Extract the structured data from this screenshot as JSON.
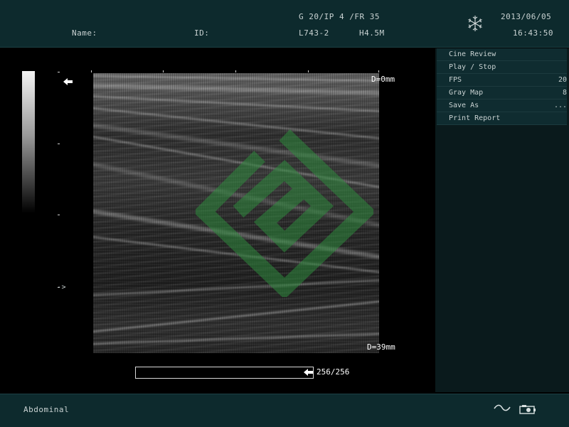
{
  "header": {
    "name_label": "Name:",
    "id_label": "ID:",
    "params": "G 20/IP 4 /FR 35",
    "probe": "L743-2",
    "frequency": "H4.5M",
    "date": "2013/06/05",
    "time": "16:43:50",
    "freeze_icon": "snowflake-icon"
  },
  "menu": {
    "items": [
      {
        "label": "Cine Review",
        "value": ""
      },
      {
        "label": "Play / Stop",
        "value": ""
      },
      {
        "label": "FPS",
        "value": "20"
      },
      {
        "label": "Gray Map",
        "value": "8"
      },
      {
        "label": "Save As",
        "value": "..."
      },
      {
        "label": "Print Report",
        "value": ""
      }
    ]
  },
  "image": {
    "depth_top": "D=0mm",
    "depth_bottom": "D=39mm",
    "focus_marker": "->"
  },
  "cine": {
    "frame_counter": "256/256",
    "progress_fraction": 1.0
  },
  "footer": {
    "preset": "Abdominal",
    "icons": [
      "wave-icon",
      "camera-icon"
    ]
  },
  "colors": {
    "bar_bg": "#0d2a2d",
    "menu_bg": "#0f2c30",
    "watermark": "#2e7d3a"
  }
}
